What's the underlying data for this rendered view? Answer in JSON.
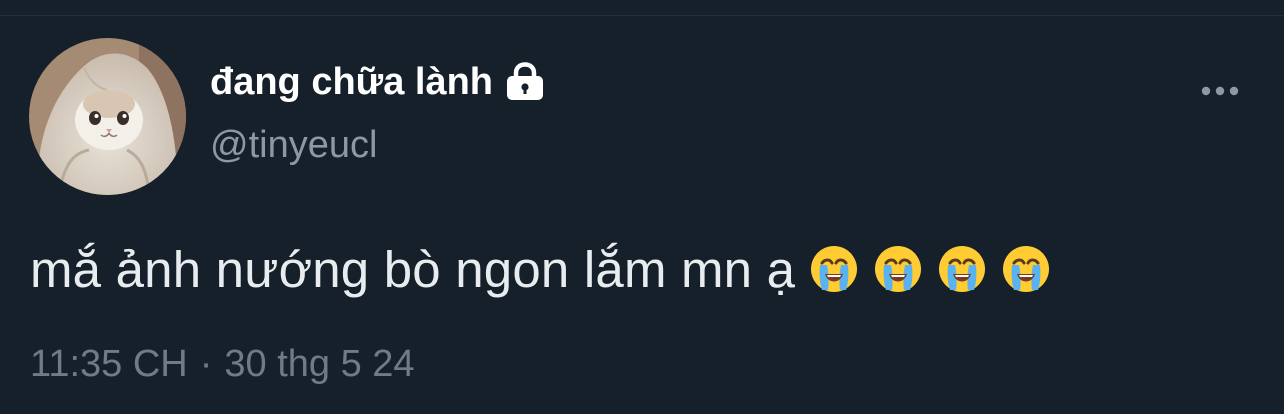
{
  "author": {
    "display_name": "đang chữa lành",
    "handle": "@tinyeucl",
    "protected_icon": "lock-icon",
    "avatar_icon": "cat-in-blanket-avatar"
  },
  "more_icon": "more-horizontal-icon",
  "tweet": {
    "text": "mắ ảnh nướng bò ngon lắm mn ạ",
    "emojis": [
      "loudly-crying-face",
      "loudly-crying-face",
      "loudly-crying-face",
      "loudly-crying-face"
    ]
  },
  "meta": {
    "time": "11:35 CH",
    "separator": "·",
    "date": "30 thg 5 24"
  },
  "colors": {
    "background": "#15202b",
    "text_primary": "#ffffff",
    "text_secondary": "#8b98a5",
    "divider": "#22303c"
  }
}
